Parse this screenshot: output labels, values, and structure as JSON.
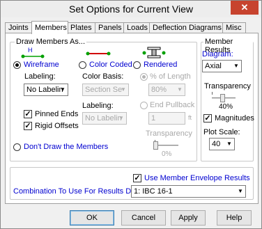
{
  "window": {
    "title": "Set Options for Current View",
    "close": "✕"
  },
  "tabs": [
    {
      "label": "Joints"
    },
    {
      "label": "Members"
    },
    {
      "label": "Plates"
    },
    {
      "label": "Panels"
    },
    {
      "label": "Loads"
    },
    {
      "label": "Deflection Diagrams"
    },
    {
      "label": "Misc"
    }
  ],
  "draw_members": {
    "group_label": "Draw Members As...",
    "wireframe_label": "Wireframe",
    "wireframe_icon_text": "H",
    "color_coded_label": "Color Coded",
    "rendered_label": "Rendered",
    "labeling_label": "Labeling:",
    "labeling_value": "No Labelin",
    "color_basis_label": "Color Basis:",
    "color_basis_value": "Section Se",
    "labeling2_label": "Labeling:",
    "labeling2_value": "No Labelin",
    "pct_length_label": "% of Length",
    "pct_length_value": "80%",
    "end_pullback_label": "End Pullback",
    "end_pullback_value": "1",
    "end_pullback_unit": "ft",
    "transparency_label": "Transparency",
    "transparency_value": "0%",
    "pinned_ends_label": "Pinned Ends",
    "rigid_offsets_label": "Rigid Offsets",
    "dont_draw_label": "Don't Draw the Members"
  },
  "member_results": {
    "group_label": "Member Results",
    "diagram_label": "Diagram:",
    "diagram_value": "Axial",
    "transparency_label": "Transparency",
    "transparency_value": "40%",
    "magnitudes_label": "Magnitudes",
    "plot_scale_label": "Plot Scale:",
    "plot_scale_value": "40"
  },
  "envelope": {
    "use_envelope_label": "Use Member Envelope Results",
    "combination_label": "Combination To Use For Results Display",
    "combination_value": "1: IBC 16-1"
  },
  "buttons": {
    "ok": "OK",
    "cancel": "Cancel",
    "apply": "Apply",
    "help": "Help"
  }
}
